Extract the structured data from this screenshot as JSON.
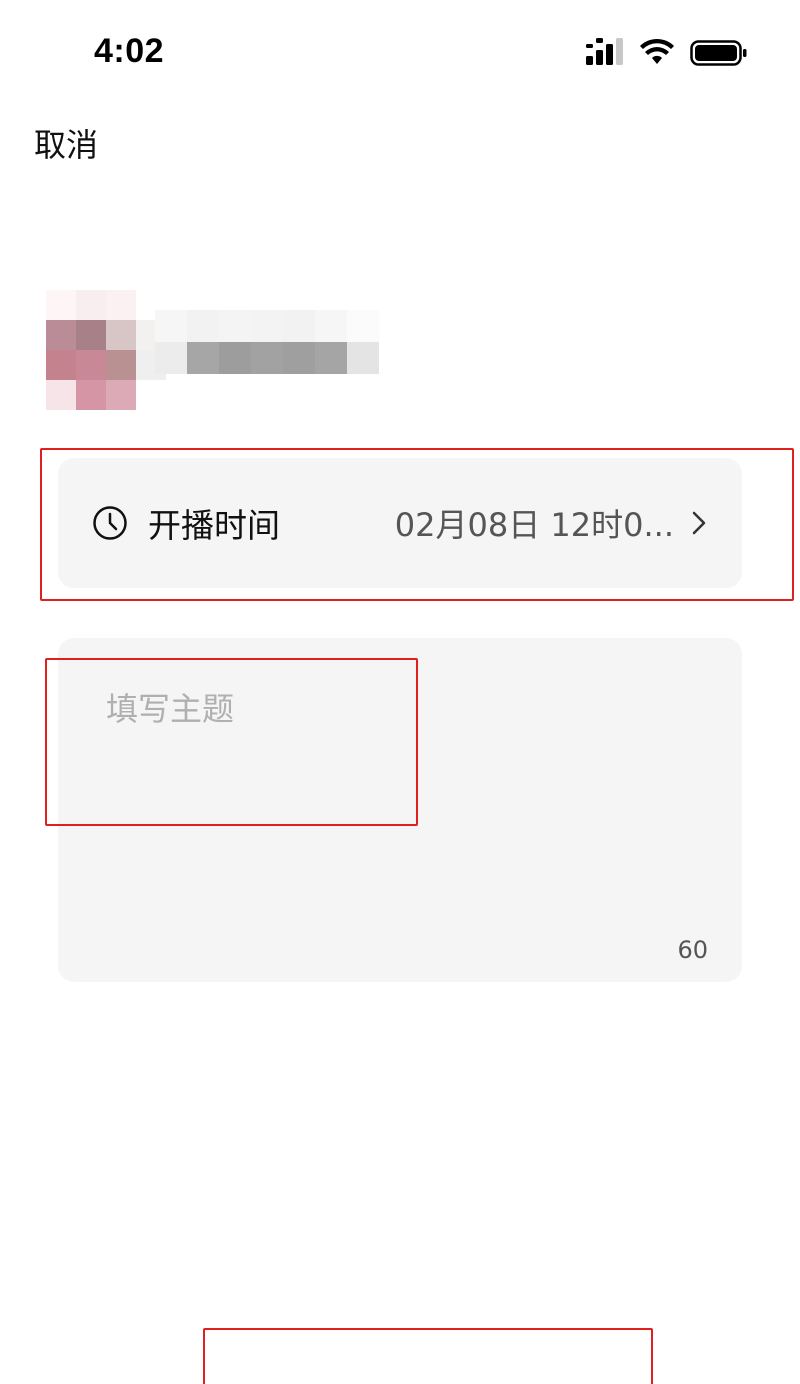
{
  "status_bar": {
    "time": "4:02",
    "icons": [
      "cellular-signal-icon",
      "wifi-icon",
      "battery-icon"
    ]
  },
  "header": {
    "cancel_label": "取消"
  },
  "user": {
    "avatar": "pixelated-avatar",
    "name": "pixelated-name"
  },
  "schedule": {
    "icon": "clock-icon",
    "label": "开播时间",
    "value": "02月08日 12时0...",
    "chevron": "chevron-right-icon"
  },
  "topic": {
    "placeholder": "填写主题",
    "value": "",
    "char_limit": "60"
  },
  "colors": {
    "card_background": "#f5f5f5",
    "annotation_red": "#e02020",
    "placeholder_gray": "#b0b0b0"
  }
}
